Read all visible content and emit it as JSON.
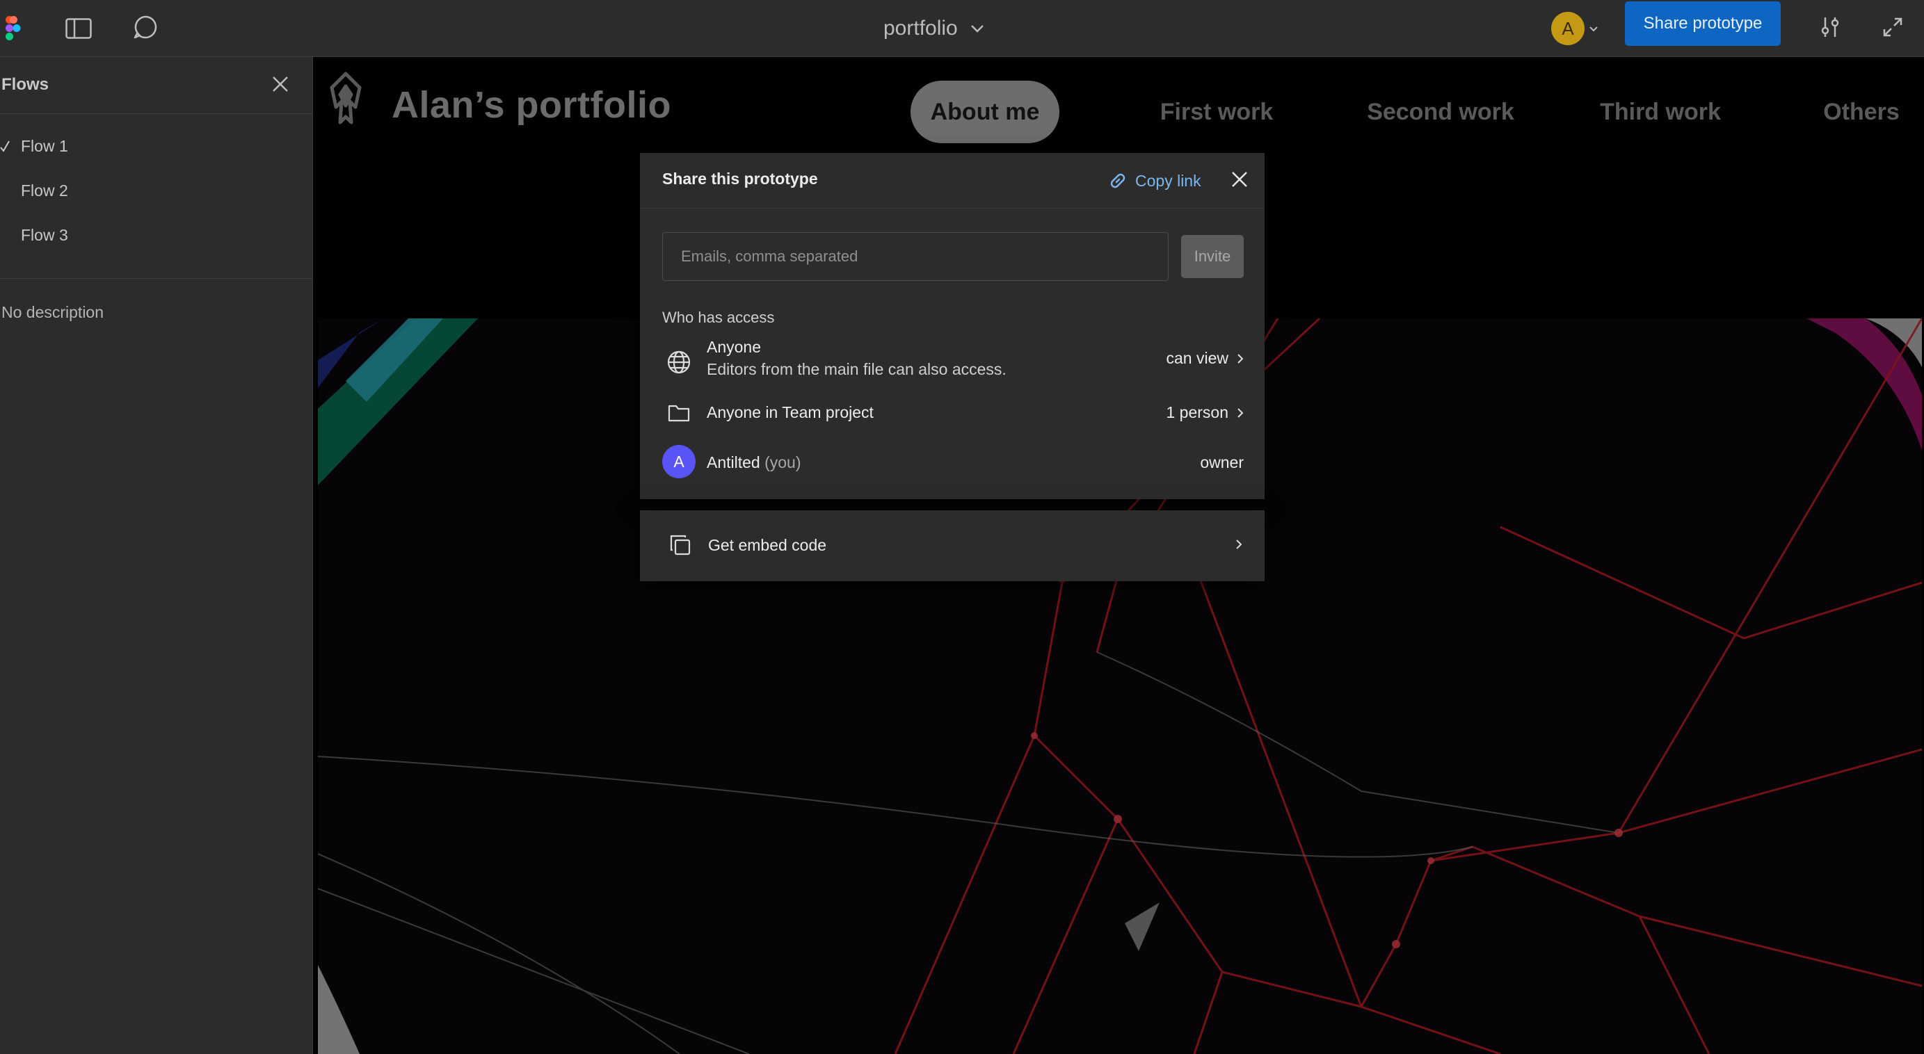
{
  "toolbar": {
    "icons": {
      "logo": "figma-logo-icon",
      "sidebar": "sidebar-toggle-icon",
      "comment": "comment-icon",
      "settings": "sliders-icon",
      "expand": "expand-icon"
    },
    "file_title": "portfolio",
    "avatar_initial": "A",
    "share_label": "Share prototype",
    "colors": {
      "share": "#0d66c2",
      "avatar": "#c49a14"
    }
  },
  "sidebar": {
    "title": "Flows",
    "flows": [
      {
        "label": "Flow 1",
        "selected": true
      },
      {
        "label": "Flow 2",
        "selected": false
      },
      {
        "label": "Flow 3",
        "selected": false
      }
    ],
    "description": "No description"
  },
  "prototype": {
    "site_title": "Alan’s portfolio",
    "nav": [
      {
        "label": "About me",
        "active": true
      },
      {
        "label": "First work",
        "active": false
      },
      {
        "label": "Second work",
        "active": false
      },
      {
        "label": "Third work",
        "active": false
      },
      {
        "label": "Others",
        "active": false
      }
    ]
  },
  "share_modal": {
    "title": "Share this prototype",
    "copy_link": "Copy link",
    "email_placeholder": "Emails, comma separated",
    "email_value": "",
    "invite_label": "Invite",
    "access_heading": "Who has access",
    "access": [
      {
        "icon": "globe-icon",
        "name": "Anyone",
        "sub": "Editors from the main file can also access.",
        "permission": "can view",
        "has_menu": true
      },
      {
        "icon": "folder-icon",
        "name": "Anyone in Team project",
        "permission": "1 person",
        "has_menu": true
      },
      {
        "icon": "avatar",
        "initial": "A",
        "name": "Antilted",
        "you": "(you)",
        "permission": "owner",
        "has_menu": false
      }
    ],
    "embed_label": "Get embed code",
    "colors": {
      "link": "#7bb7ef",
      "user_avatar": "#5a54f6"
    }
  }
}
